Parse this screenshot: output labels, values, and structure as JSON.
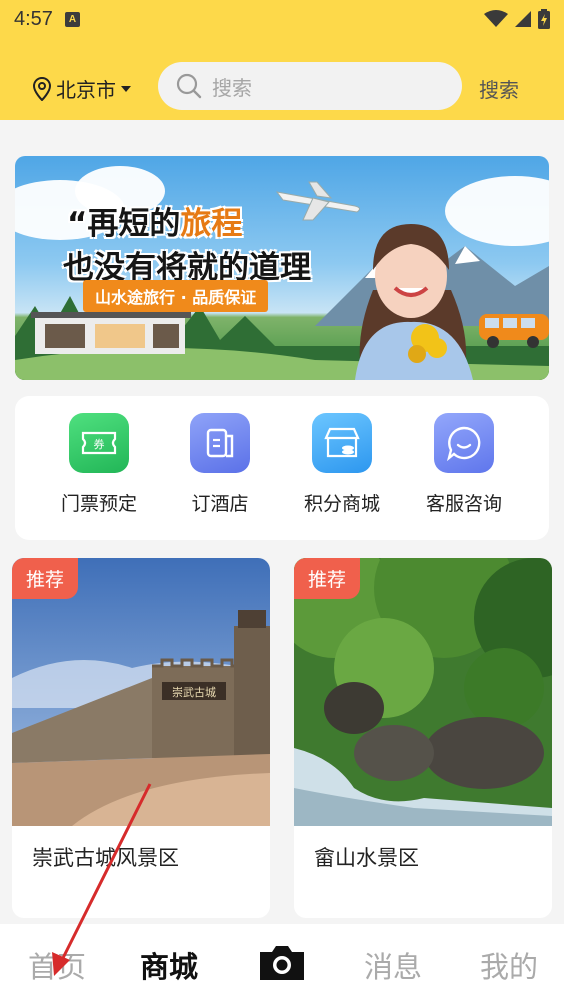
{
  "status_bar": {
    "time": "4:57",
    "notification_letter": "A"
  },
  "header": {
    "city": "北京市",
    "search_placeholder": "搜索",
    "search_button": "搜索"
  },
  "banner": {
    "title_line1_prefix": "再短的",
    "title_line1_accent": "旅程",
    "title_line2": "也没有将就的道理",
    "tag": "山水途旅行 · 品质保证"
  },
  "quick_menu": [
    {
      "label": "门票预定",
      "icon": "ticket-icon",
      "color": "#2ecc71"
    },
    {
      "label": "订酒店",
      "icon": "hotel-icon",
      "color": "#6f86f0"
    },
    {
      "label": "积分商城",
      "icon": "store-icon",
      "color": "#3aa9f3"
    },
    {
      "label": "客服咨询",
      "icon": "chat-bubble-icon",
      "color": "#7087f2"
    }
  ],
  "quick_menu_ticket_glyph": "券",
  "cards": [
    {
      "badge": "推荐",
      "title": "崇武古城风景区",
      "sign_text": "崇武古城"
    },
    {
      "badge": "推荐",
      "title": "畲山水景区"
    }
  ],
  "bottom_nav": {
    "home": "首页",
    "mall": "商城",
    "camera": "camera-icon",
    "messages": "消息",
    "mine": "我的"
  },
  "colors": {
    "header_bg": "#fdd94a",
    "badge": "#f0604c",
    "accent_orange": "#e67a14",
    "nav_active": "#111111",
    "nav_inactive": "#aaaaaa"
  }
}
